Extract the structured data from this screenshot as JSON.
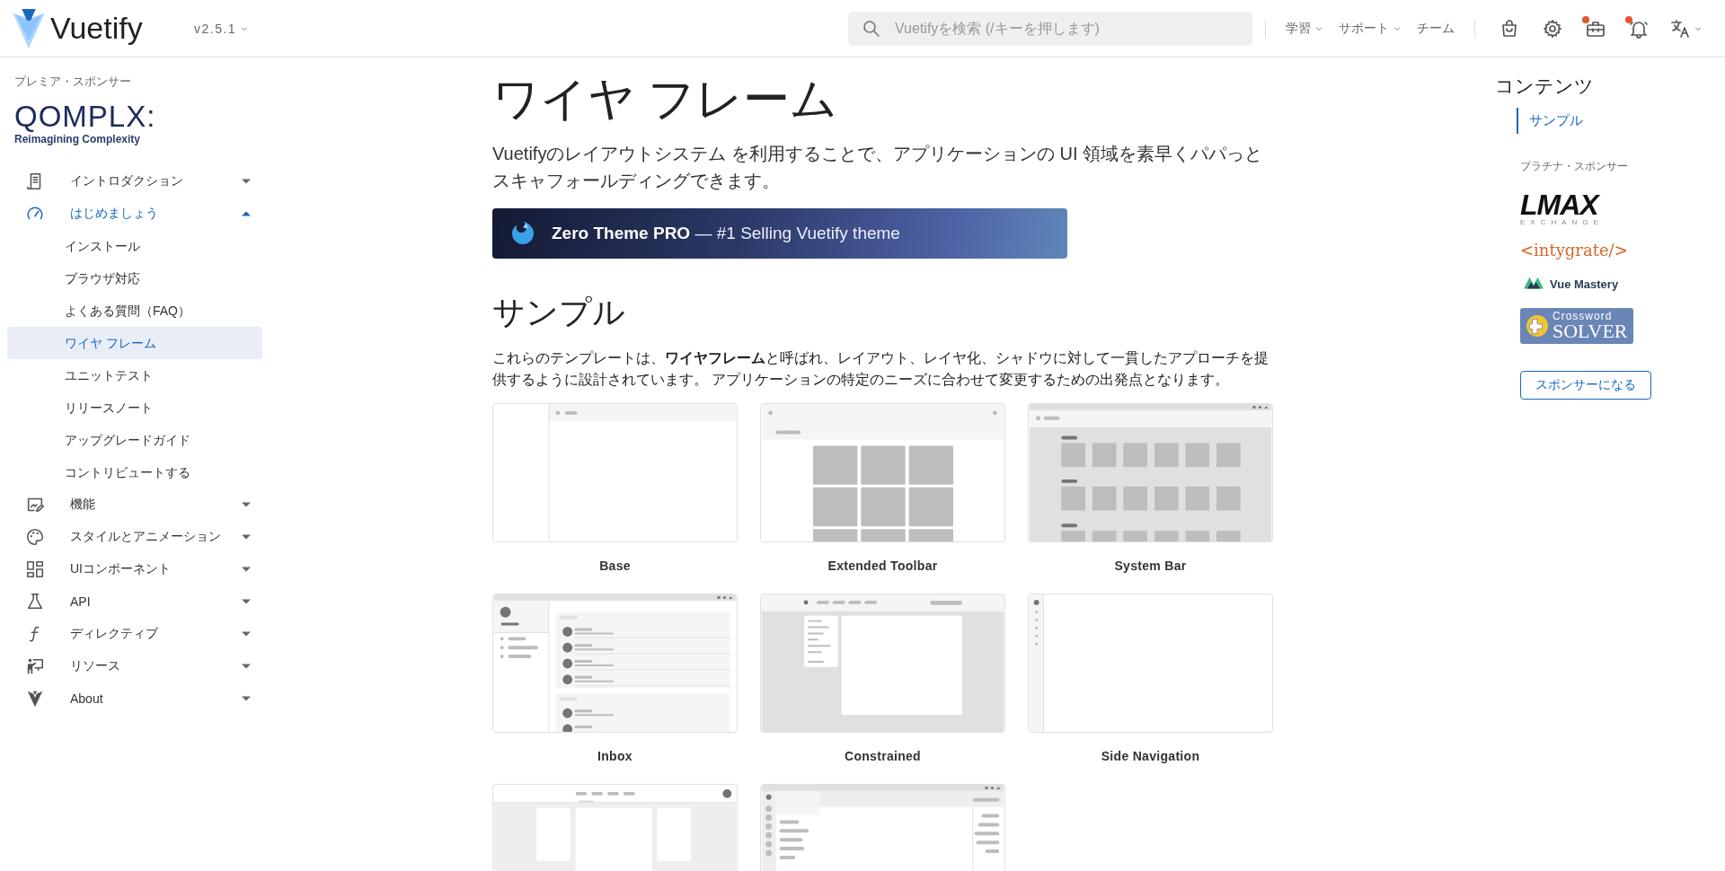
{
  "header": {
    "site_title": "Vuetify",
    "version": {
      "label": "v2.5.1",
      "has_menu": true
    },
    "search": {
      "placeholder": "Vuetifyを検索 (/キーを押します)"
    },
    "nav_links": [
      {
        "label": "学習",
        "has_menu": true
      },
      {
        "label": "サポート",
        "has_menu": true
      },
      {
        "label": "チーム",
        "has_menu": false
      }
    ],
    "actions": [
      {
        "kind": "bag",
        "badge": false,
        "has_menu": false
      },
      {
        "kind": "gear",
        "badge": false,
        "has_menu": false
      },
      {
        "kind": "toolbox",
        "badge": true,
        "has_menu": false
      },
      {
        "kind": "bell",
        "badge": true,
        "has_menu": false
      },
      {
        "kind": "translate",
        "badge": false,
        "has_menu": true
      }
    ]
  },
  "sidebar": {
    "sponsor_label": "プレミア・スポンサー",
    "sponsor": {
      "name": "QOMPLX:",
      "tagline": "Reimagining Complexity"
    },
    "items": [
      {
        "label": "イントロダクション",
        "kind": "document",
        "selected": false,
        "expanded": false
      },
      {
        "label": "はじめましょう",
        "kind": "gauge",
        "selected": true,
        "expanded": true,
        "children": [
          {
            "label": "インストール",
            "selected": false
          },
          {
            "label": "ブラウザ対応",
            "selected": false
          },
          {
            "label": "よくある質問（FAQ）",
            "selected": false
          },
          {
            "label": "ワイヤ フレーム",
            "selected": true
          },
          {
            "label": "ユニットテスト",
            "selected": false
          },
          {
            "label": "リリースノート",
            "selected": false
          },
          {
            "label": "アップグレードガイド",
            "selected": false
          },
          {
            "label": "コントリビュートする",
            "selected": false
          }
        ]
      },
      {
        "label": "機能",
        "kind": "edit",
        "selected": false,
        "expanded": false
      },
      {
        "label": "スタイルとアニメーション",
        "kind": "palette",
        "selected": false,
        "expanded": false
      },
      {
        "label": "UIコンポーネント",
        "kind": "grid",
        "selected": false,
        "expanded": false
      },
      {
        "label": "API",
        "kind": "flask",
        "selected": false,
        "expanded": false
      },
      {
        "label": "ディレクティブ",
        "kind": "function",
        "selected": false,
        "expanded": false
      },
      {
        "label": "リソース",
        "kind": "presenter",
        "selected": false,
        "expanded": false
      },
      {
        "label": "About",
        "kind": "vlogo",
        "selected": false,
        "expanded": false
      }
    ]
  },
  "main": {
    "title": "ワイヤ フレーム",
    "intro": "Vuetifyのレイアウトシステム を利用することで、アプリケーションの UI 領域を素早くパパっとスキャフォールディングできます。",
    "banner": {
      "text": "**Zero Theme PRO** — #1 Selling Vuetify theme"
    },
    "section_title": "サンプル",
    "section_text": "これらのテンプレートは、**ワイヤフレーム**と呼ばれ、レイアウト、レイヤ化、シャドウに対して一貫したアプローチを提供するように設計されています。 アプリケーションの特定のニーズに合わせて変更するための出発点となります。",
    "templates": [
      {
        "kind": "base",
        "name": "Base"
      },
      {
        "kind": "extended",
        "name": "Extended Toolbar"
      },
      {
        "kind": "systembar",
        "name": "System Bar"
      },
      {
        "kind": "inbox",
        "name": "Inbox"
      },
      {
        "kind": "constrained",
        "name": "Constrained"
      },
      {
        "kind": "sidenav",
        "name": "Side Navigation"
      },
      {
        "kind": "threecolumn"
      },
      {
        "kind": "discord"
      }
    ]
  },
  "toc": {
    "title": "コンテンツ",
    "items": [
      {
        "label": "サンプル",
        "selected": true
      }
    ],
    "sponsor_label": "プラチナ・スポンサー",
    "sponsors": [
      {
        "kind": "lmax",
        "lines": [
          "LMAX",
          "EXCHANGE"
        ]
      },
      {
        "kind": "intygrate",
        "lines": [
          "<intygrate/>"
        ]
      },
      {
        "kind": "vuemastery",
        "lines": [
          "Vue Mastery"
        ]
      },
      {
        "kind": "crossword",
        "lines": [
          "Crossword",
          "SOLVER"
        ]
      }
    ],
    "button": "スポンサーになる"
  }
}
